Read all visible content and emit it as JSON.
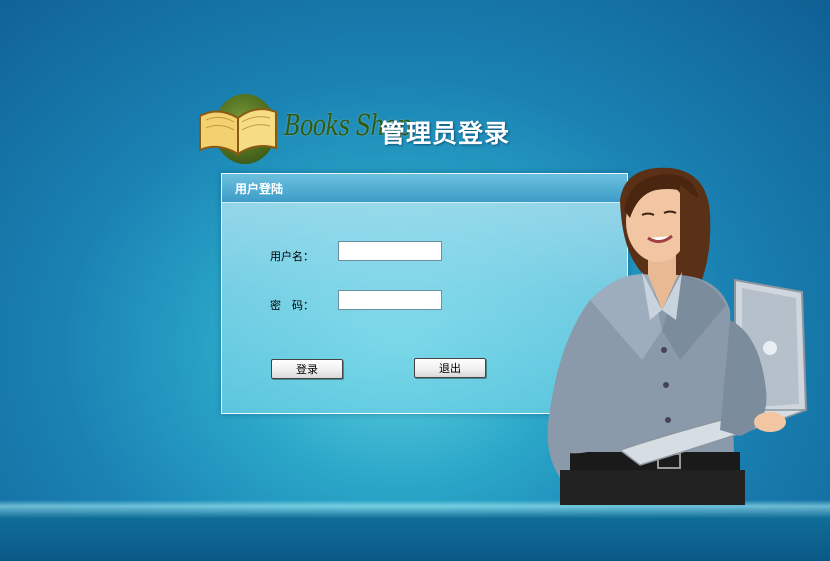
{
  "logo": {
    "brand": "Books Shop",
    "title": "管理员登录",
    "icon": "open-book-icon"
  },
  "login_panel": {
    "title": "用户登陆",
    "username_label": "用户名：",
    "username_value": "",
    "password_label": "密　码：",
    "password_value": "",
    "login_button": "登录",
    "exit_button": "退出"
  },
  "colors": {
    "background": "#1a82b3",
    "panel_header": "#3c9cc8",
    "brand_green": "#2f5a12"
  },
  "illustration": "woman-holding-laptop"
}
